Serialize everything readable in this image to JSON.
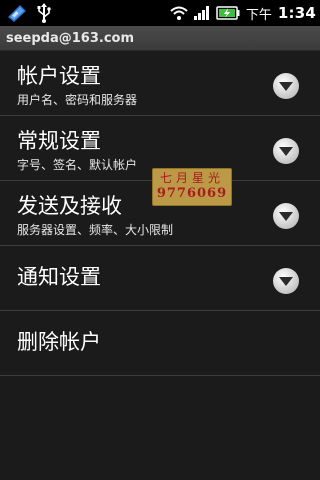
{
  "status_bar": {
    "ampm": "下午",
    "time": "1:34",
    "icons": [
      "app-icon",
      "usb-icon",
      "wifi-icon",
      "signal-icon",
      "battery-charging-icon"
    ]
  },
  "account": {
    "email": "seepda@163.com"
  },
  "menu": {
    "items": [
      {
        "title": "帐户设置",
        "subtitle": "用户名、密码和服务器"
      },
      {
        "title": "常规设置",
        "subtitle": "字号、签名、默认帐户"
      },
      {
        "title": "发送及接收",
        "subtitle": "服务器设置、频率、大小限制"
      },
      {
        "title": "通知设置",
        "subtitle": ""
      },
      {
        "title": "删除帐户",
        "subtitle": ""
      }
    ]
  },
  "watermark": {
    "line1": "七月星光",
    "line2": "9776069"
  },
  "colors": {
    "background": "#1b1b1b",
    "header": "#444444",
    "divider": "#3c3c3c",
    "stamp": "#c9a44a"
  }
}
